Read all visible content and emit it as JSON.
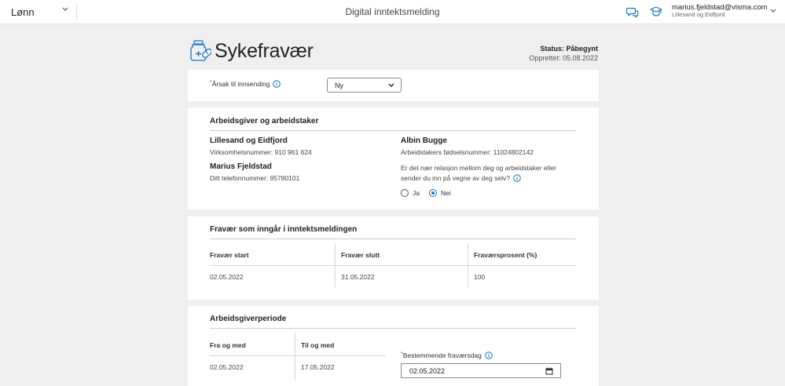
{
  "header": {
    "app_name": "Lønn",
    "title": "Digital inntektsmelding",
    "user_email": "marius.fjeldstad@visma.com",
    "user_company": "Lillesand og Eidfjord",
    "icons": [
      "chevron-down-icon",
      "chat-icon",
      "graduation-cap-icon"
    ]
  },
  "page": {
    "title": "Sykefravær",
    "status": "Status: Påbegynt",
    "created": "Opprettet: 05.08.2022"
  },
  "reason": {
    "required_mark": "*",
    "label": "Årsak til innsending",
    "selected": "Ny"
  },
  "employer": {
    "section_title": "Arbeidsgiver og arbeidstaker",
    "company_name": "Lillesand og Eidfjord",
    "org_number": "Virksomhetsnummer: 910 961 624",
    "contact_name": "Marius Fjeldstad",
    "phone": "Ditt telefonnummer: 95780101",
    "employee_name": "Albin Bugge",
    "employee_id": "Arbeidstakers fødselsnummer: 11024802142",
    "relation_question_line1": "Er det nær relasjon mellom deg og arbeidstaker eller",
    "relation_question_line2": "sender du inn på vegne av deg selv?",
    "options": [
      {
        "label": "Ja",
        "checked": false
      },
      {
        "label": "Nei",
        "checked": true
      }
    ]
  },
  "absence": {
    "section_title": "Fravær som inngår i inntektsmeldingen",
    "columns": [
      "Fravær start",
      "Fravær slutt",
      "Fraværsprosent (%)"
    ],
    "rows": [
      [
        "02.05.2022",
        "31.05.2022",
        "100"
      ]
    ]
  },
  "employer_period": {
    "section_title": "Arbeidsgiverperiode",
    "columns": [
      "Fra og med",
      "Til og med"
    ],
    "rows": [
      [
        "02.05.2022",
        "17.05.2022"
      ]
    ],
    "determining_day_required": "*",
    "determining_day_label": "Bestemmende fraværsdag",
    "determining_day_value": "02.05.2022"
  },
  "colors": {
    "accent": "#1b73c6",
    "background": "#efefef",
    "card": "#ffffff"
  }
}
